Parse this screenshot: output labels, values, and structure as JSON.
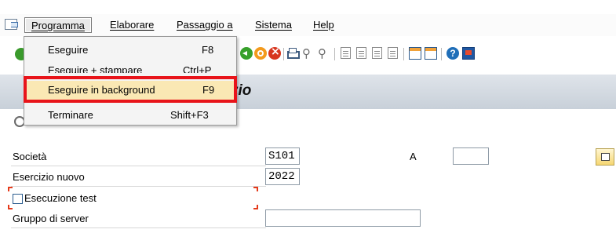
{
  "menubar": {
    "items": [
      {
        "label": "Programma"
      },
      {
        "label": "Elaborare"
      },
      {
        "label": "Passaggio a"
      },
      {
        "label": "Sistema"
      },
      {
        "label": "Help"
      }
    ]
  },
  "dropdown": {
    "items": [
      {
        "label": "Eseguire",
        "shortcut": "F8"
      },
      {
        "label": "Eseguire + stampare",
        "shortcut": "Ctrl+P"
      },
      {
        "label": "Eseguire in background",
        "shortcut": "F9",
        "highlighted": true
      },
      {
        "label": "Terminare",
        "shortcut": "Shift+F3"
      }
    ]
  },
  "titlebar": {
    "title_fragment": "zio"
  },
  "toolbar": {
    "icons": [
      "enter-icon",
      "back-icon",
      "exit-icon",
      "cancel-icon",
      "print-icon",
      "find-icon",
      "find-next-icon",
      "first-page-icon",
      "previous-page-icon",
      "next-page-icon",
      "last-page-icon",
      "new-session-icon",
      "shortcut-icon",
      "help-icon",
      "customize-layout-icon"
    ]
  },
  "form": {
    "company": {
      "label": "Società",
      "value": "S101",
      "to_label": "A",
      "to_value": ""
    },
    "fiscal_year": {
      "label": "Esercizio nuovo",
      "value": "2022"
    },
    "test_run": {
      "label": "Esecuzione test",
      "checked": false
    },
    "server_group": {
      "label": "Gruppo di server",
      "value": ""
    }
  },
  "colors": {
    "highlight_border": "#e8141a",
    "highlight_fill": "#fae8b4",
    "titlebar": "#c8d0d9"
  }
}
